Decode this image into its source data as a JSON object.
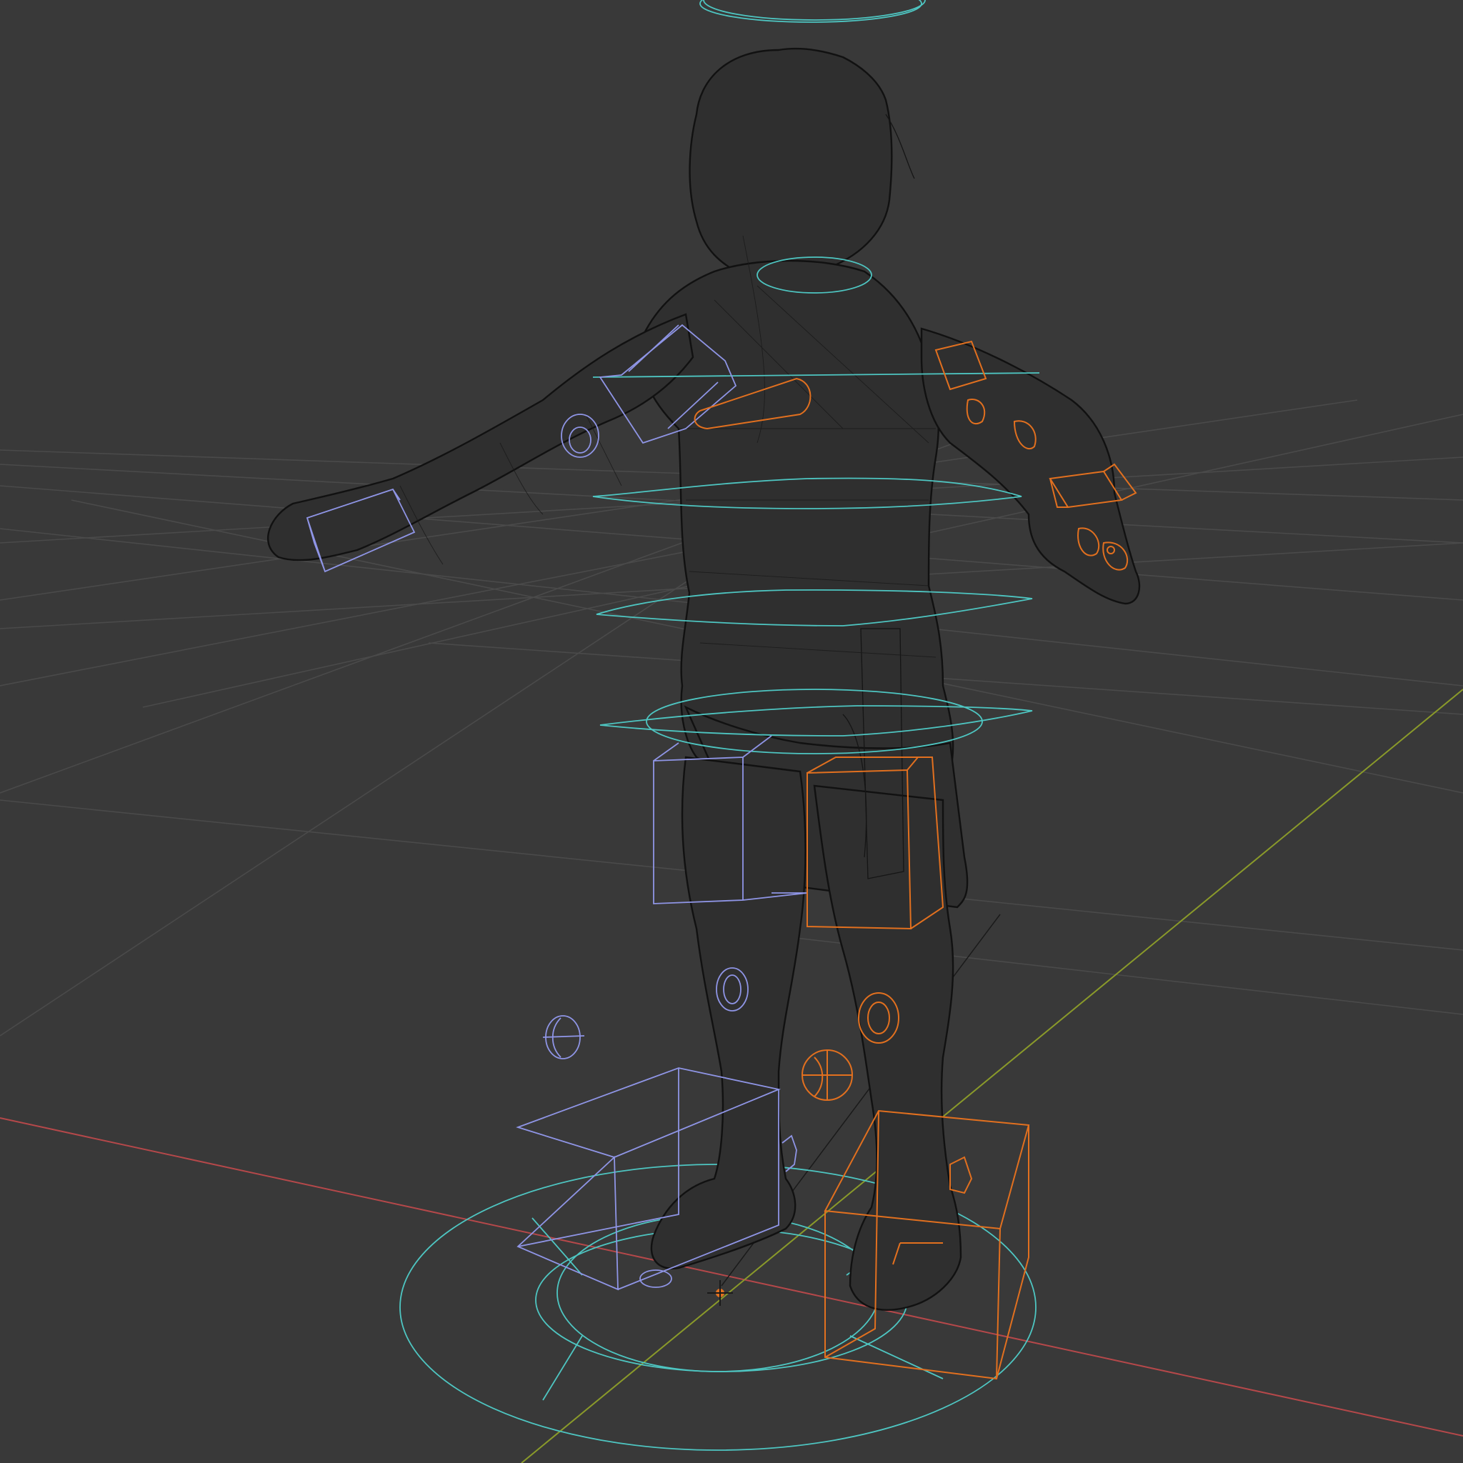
{
  "viewport": {
    "shading_mode": "wireframe",
    "background_color": "#393939",
    "grid_color": "#4a4a4a",
    "x_axis_color": "#b5484a",
    "y_axis_color": "#8a9a2a",
    "mesh_wire_color": "#151515",
    "rig_colors": {
      "root_and_torso_controls": "#4ec6c2",
      "left_side_controls": "#8f95e6",
      "right_side_controls": "#e2701f"
    },
    "object_origin_icon": "crosshair-origin-icon"
  }
}
